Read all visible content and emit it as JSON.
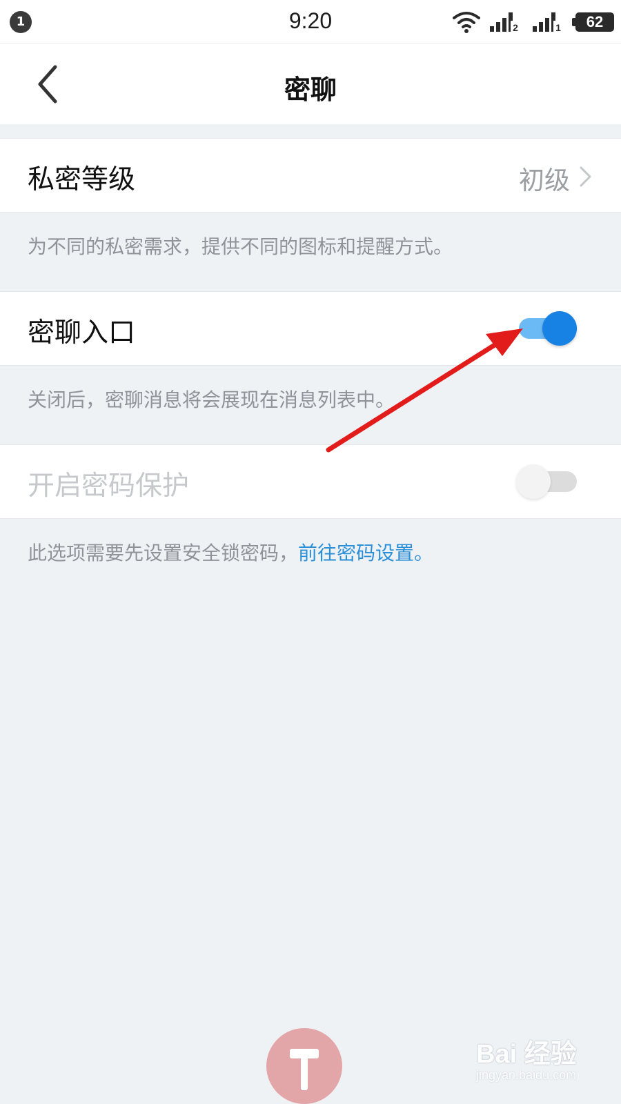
{
  "status_bar": {
    "notification_count": "1",
    "time": "9:20",
    "battery": "62",
    "sim1_label": "2",
    "sim2_label": "1"
  },
  "nav": {
    "title": "密聊",
    "back_icon": "chevron-left-icon"
  },
  "settings": {
    "privacy_level": {
      "label": "私密等级",
      "value": "初级",
      "hint": "为不同的私密需求，提供不同的图标和提醒方式。"
    },
    "entry": {
      "label": "密聊入口",
      "enabled": true,
      "hint": "关闭后，密聊消息将会展现在消息列表中。"
    },
    "password_protect": {
      "label": "开启密码保护",
      "enabled": false,
      "disabled": true,
      "hint": "此选项需要先设置安全锁密码，",
      "hint_link": "前往密码设置。"
    }
  },
  "colors": {
    "accent": "#1782e3",
    "link": "#2b8fd8",
    "annotation_arrow": "#e21b1b",
    "background": "#eff2f5"
  },
  "watermark": {
    "brand": "Bai 经验",
    "site": "jingyan.baidu.com"
  }
}
